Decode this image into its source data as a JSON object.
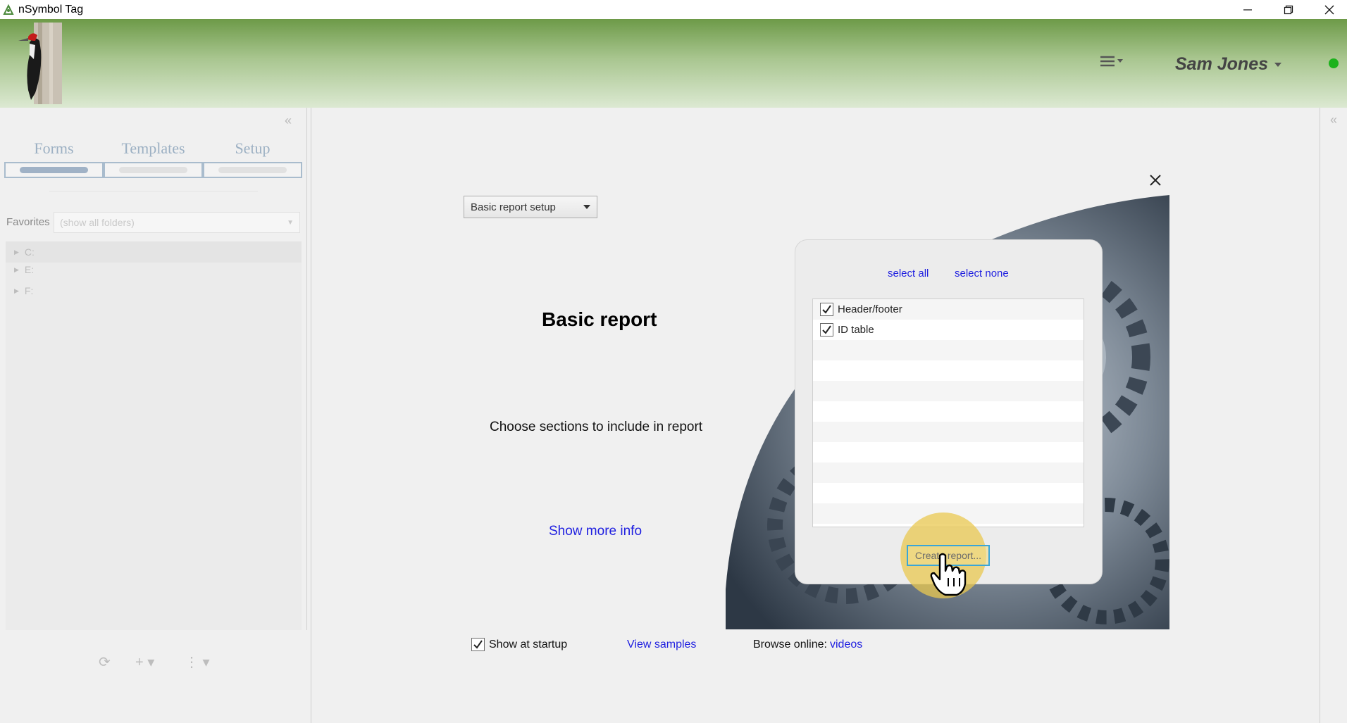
{
  "window": {
    "title": "nSymbol Tag"
  },
  "header": {
    "user_name": "Sam Jones",
    "status_color": "#1cb21c"
  },
  "left_panel": {
    "tabs": [
      {
        "label": "Forms",
        "active": true
      },
      {
        "label": "Templates",
        "active": false
      },
      {
        "label": "Setup",
        "active": false
      }
    ],
    "favorites_label": "Favorites",
    "favorites_value": "(show all folders)",
    "drives": [
      "C:",
      "E:",
      "F:"
    ]
  },
  "main": {
    "report_select_value": "Basic report setup",
    "title": "Basic report",
    "subtitle": "Choose sections to include in report",
    "more_info_link": "Show more info",
    "select_all": "select all",
    "select_none": "select none",
    "sections": [
      {
        "label": "Header/footer",
        "checked": true
      },
      {
        "label": "ID table",
        "checked": true
      }
    ],
    "create_button": "Create report...",
    "show_at_startup_label": "Show at startup",
    "show_at_startup_checked": true,
    "view_samples_link": "View samples",
    "browse_online_label": "Browse online:",
    "videos_link": "videos"
  },
  "colors": {
    "link": "#1f1fe0",
    "accent_green": "#6d9a48",
    "focus_blue": "#3aa6d8"
  }
}
